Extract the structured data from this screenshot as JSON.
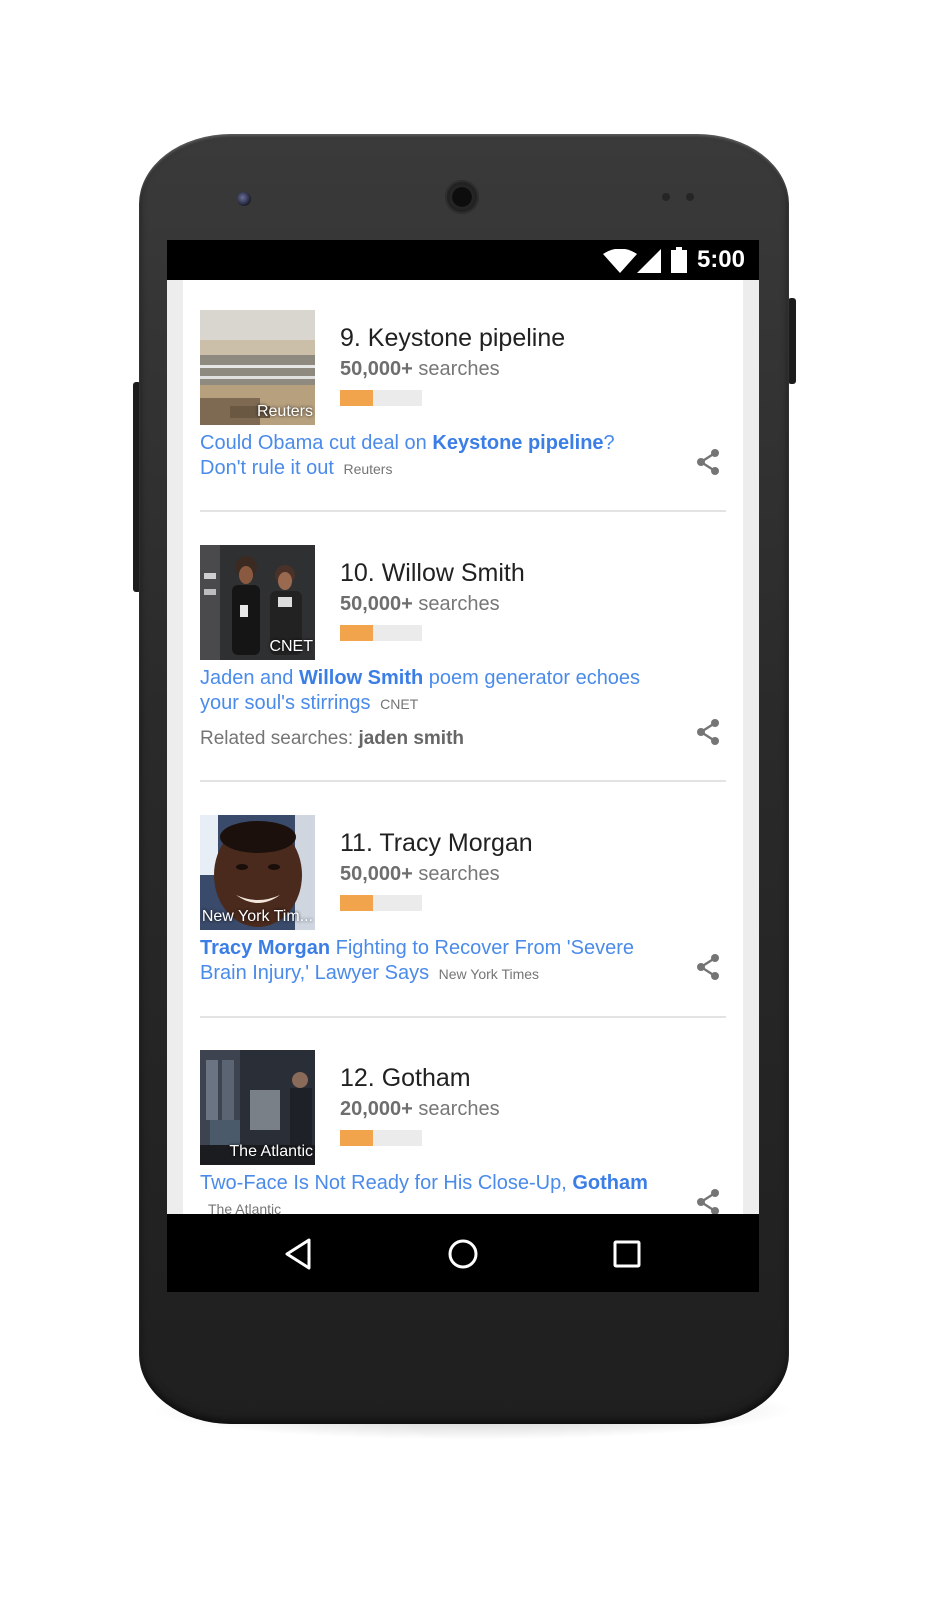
{
  "status_bar": {
    "time": "5:00",
    "icons": [
      "wifi-icon",
      "cell-signal-icon",
      "battery-icon"
    ]
  },
  "trends": [
    {
      "rank_title": "9. Keystone pipeline",
      "searches_count": "50,000+",
      "searches_label": "searches",
      "bar_fill_fraction": 0.4,
      "thumb_source": "Reuters",
      "headline_parts": [
        {
          "text": "Could Obama cut deal on ",
          "bold": false
        },
        {
          "text": "Keystone pipeline",
          "bold": true
        },
        {
          "text": "? Don't rule it out",
          "bold": false
        }
      ],
      "headline_source": "Reuters",
      "related": null
    },
    {
      "rank_title": "10. Willow Smith",
      "searches_count": "50,000+",
      "searches_label": "searches",
      "bar_fill_fraction": 0.4,
      "thumb_source": "CNET",
      "headline_parts": [
        {
          "text": "Jaden and ",
          "bold": false
        },
        {
          "text": "Willow Smith",
          "bold": true
        },
        {
          "text": " poem generator echoes your soul's stirrings",
          "bold": false
        }
      ],
      "headline_source": "CNET",
      "related": {
        "label": "Related searches:",
        "term": "jaden smith"
      }
    },
    {
      "rank_title": "11. Tracy Morgan",
      "searches_count": "50,000+",
      "searches_label": "searches",
      "bar_fill_fraction": 0.4,
      "thumb_source": "New York Tim...",
      "headline_parts": [
        {
          "text": "Tracy Morgan",
          "bold": true
        },
        {
          "text": " Fighting to Recover From 'Severe Brain Injury,' Lawyer Says",
          "bold": false
        }
      ],
      "headline_source": "New York Times",
      "related": null
    },
    {
      "rank_title": "12. Gotham",
      "searches_count": "20,000+",
      "searches_label": "searches",
      "bar_fill_fraction": 0.4,
      "thumb_source": "The Atlantic",
      "headline_parts": [
        {
          "text": "Two-Face Is Not Ready for His Close-Up, ",
          "bold": false
        },
        {
          "text": "Gotham",
          "bold": true
        }
      ],
      "headline_source": "The Atlantic",
      "related": null
    }
  ],
  "nav_bar": {
    "buttons": [
      "back-icon",
      "home-icon",
      "recents-icon"
    ]
  },
  "colors": {
    "link_blue": "#4a8bea",
    "bar_orange": "#f2a44d",
    "bar_track": "#ebebeb",
    "content_bg": "#ededed"
  }
}
